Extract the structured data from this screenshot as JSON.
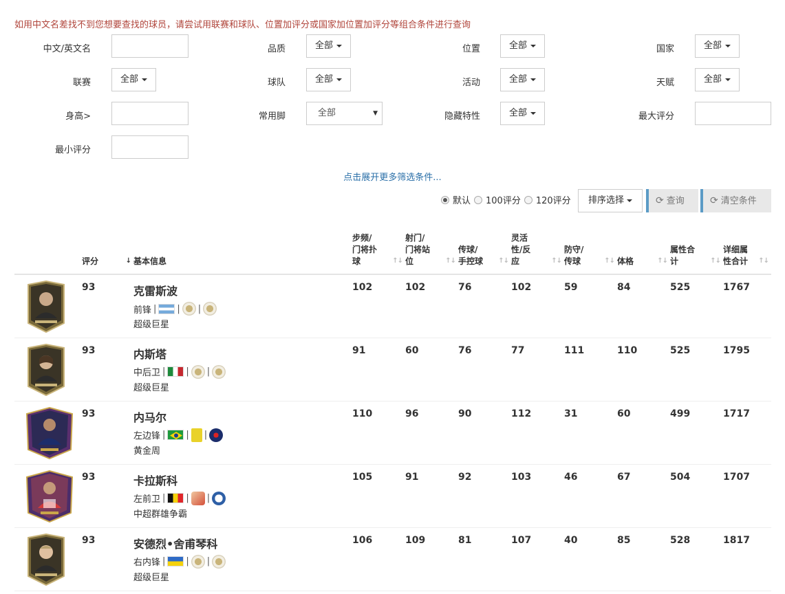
{
  "hint": "如用中文名差找不到您想要查找的球员，请尝试用联赛和球队、位置加评分或国家加位置加评分等组合条件进行查询",
  "filters": {
    "name_label": "中文/英文名",
    "quality_label": "品质",
    "quality_value": "全部",
    "position_label": "位置",
    "position_value": "全部",
    "country_label": "国家",
    "country_value": "全部",
    "league_label": "联赛",
    "league_value": "全部",
    "team_label": "球队",
    "team_value": "全部",
    "event_label": "活动",
    "event_value": "全部",
    "talent_label": "天赋",
    "talent_value": "全部",
    "height_label": "身高>",
    "foot_label": "常用脚",
    "foot_value": "全部",
    "hidden_label": "隐藏特性",
    "hidden_value": "全部",
    "max_label": "最大评分",
    "min_label": "最小评分"
  },
  "expand_link": "点击展开更多筛选条件...",
  "rating_options": {
    "default": "默认",
    "r100": "100评分",
    "r120": "120评分",
    "selected": "默认"
  },
  "sort_button": "排序选择",
  "query_button": "查询",
  "clear_button": "清空条件",
  "table": {
    "headers": {
      "rating": "评分",
      "info": "基本信息",
      "pace_line1": "步频/",
      "pace_line2": "门将扑",
      "pace_line3": "球",
      "shoot_line1": "射门/",
      "shoot_line2": "门将站",
      "shoot_line3": "位",
      "pass_line1": "传球/",
      "pass_line2": "手控球",
      "agile_line1": "灵活",
      "agile_line2": "性/反",
      "agile_line3": "应",
      "def_line1": "防守/",
      "def_line2": "传球",
      "phys": "体格",
      "total_line1": "属性合",
      "total_line2": "计",
      "detail_line1": "详细属",
      "detail_line2": "性合计"
    },
    "rows": [
      {
        "rating": "93",
        "name": "克雷斯波",
        "position": "前锋",
        "type": "超级巨星",
        "pace": "102",
        "shoot": "102",
        "pass": "76",
        "agile": "102",
        "def": "59",
        "phys": "84",
        "total": "525",
        "detail": "1767",
        "flag": "argentina-flag",
        "badges": [
          "icon-badge",
          "icon-badge"
        ]
      },
      {
        "rating": "93",
        "name": "内斯塔",
        "position": "中后卫",
        "type": "超级巨星",
        "pace": "91",
        "shoot": "60",
        "pass": "76",
        "agile": "77",
        "def": "111",
        "phys": "110",
        "total": "525",
        "detail": "1795",
        "flag": "italy-flag",
        "badges": [
          "icon-badge",
          "icon-badge"
        ]
      },
      {
        "rating": "93",
        "name": "内马尔",
        "position": "左边锋",
        "type": "黄金周",
        "pace": "110",
        "shoot": "96",
        "pass": "90",
        "agile": "112",
        "def": "31",
        "phys": "60",
        "total": "499",
        "detail": "1717",
        "flag": "brazil-flag",
        "badges": [
          "ligue1-badge",
          "psg-badge"
        ]
      },
      {
        "rating": "93",
        "name": "卡拉斯科",
        "position": "左前卫",
        "type": "中超群雄争霸",
        "pace": "105",
        "shoot": "91",
        "pass": "92",
        "agile": "103",
        "def": "46",
        "phys": "67",
        "total": "504",
        "detail": "1707",
        "flag": "belgium-flag",
        "badges": [
          "csl-badge",
          "dalian-badge"
        ]
      },
      {
        "rating": "93",
        "name": "安德烈•舍甫琴科",
        "position": "右内锋",
        "type": "超级巨星",
        "pace": "106",
        "shoot": "109",
        "pass": "81",
        "agile": "107",
        "def": "40",
        "phys": "85",
        "total": "528",
        "detail": "1817",
        "flag": "ukraine-flag",
        "badges": [
          "icon-badge",
          "icon-badge"
        ]
      }
    ]
  },
  "colors": {
    "hint": "#b0443a",
    "link": "#2a6fa8",
    "button_accent": "#5b9bc6",
    "icon_card": "#8a7a4a",
    "gold_week": "#5a2f6e"
  }
}
